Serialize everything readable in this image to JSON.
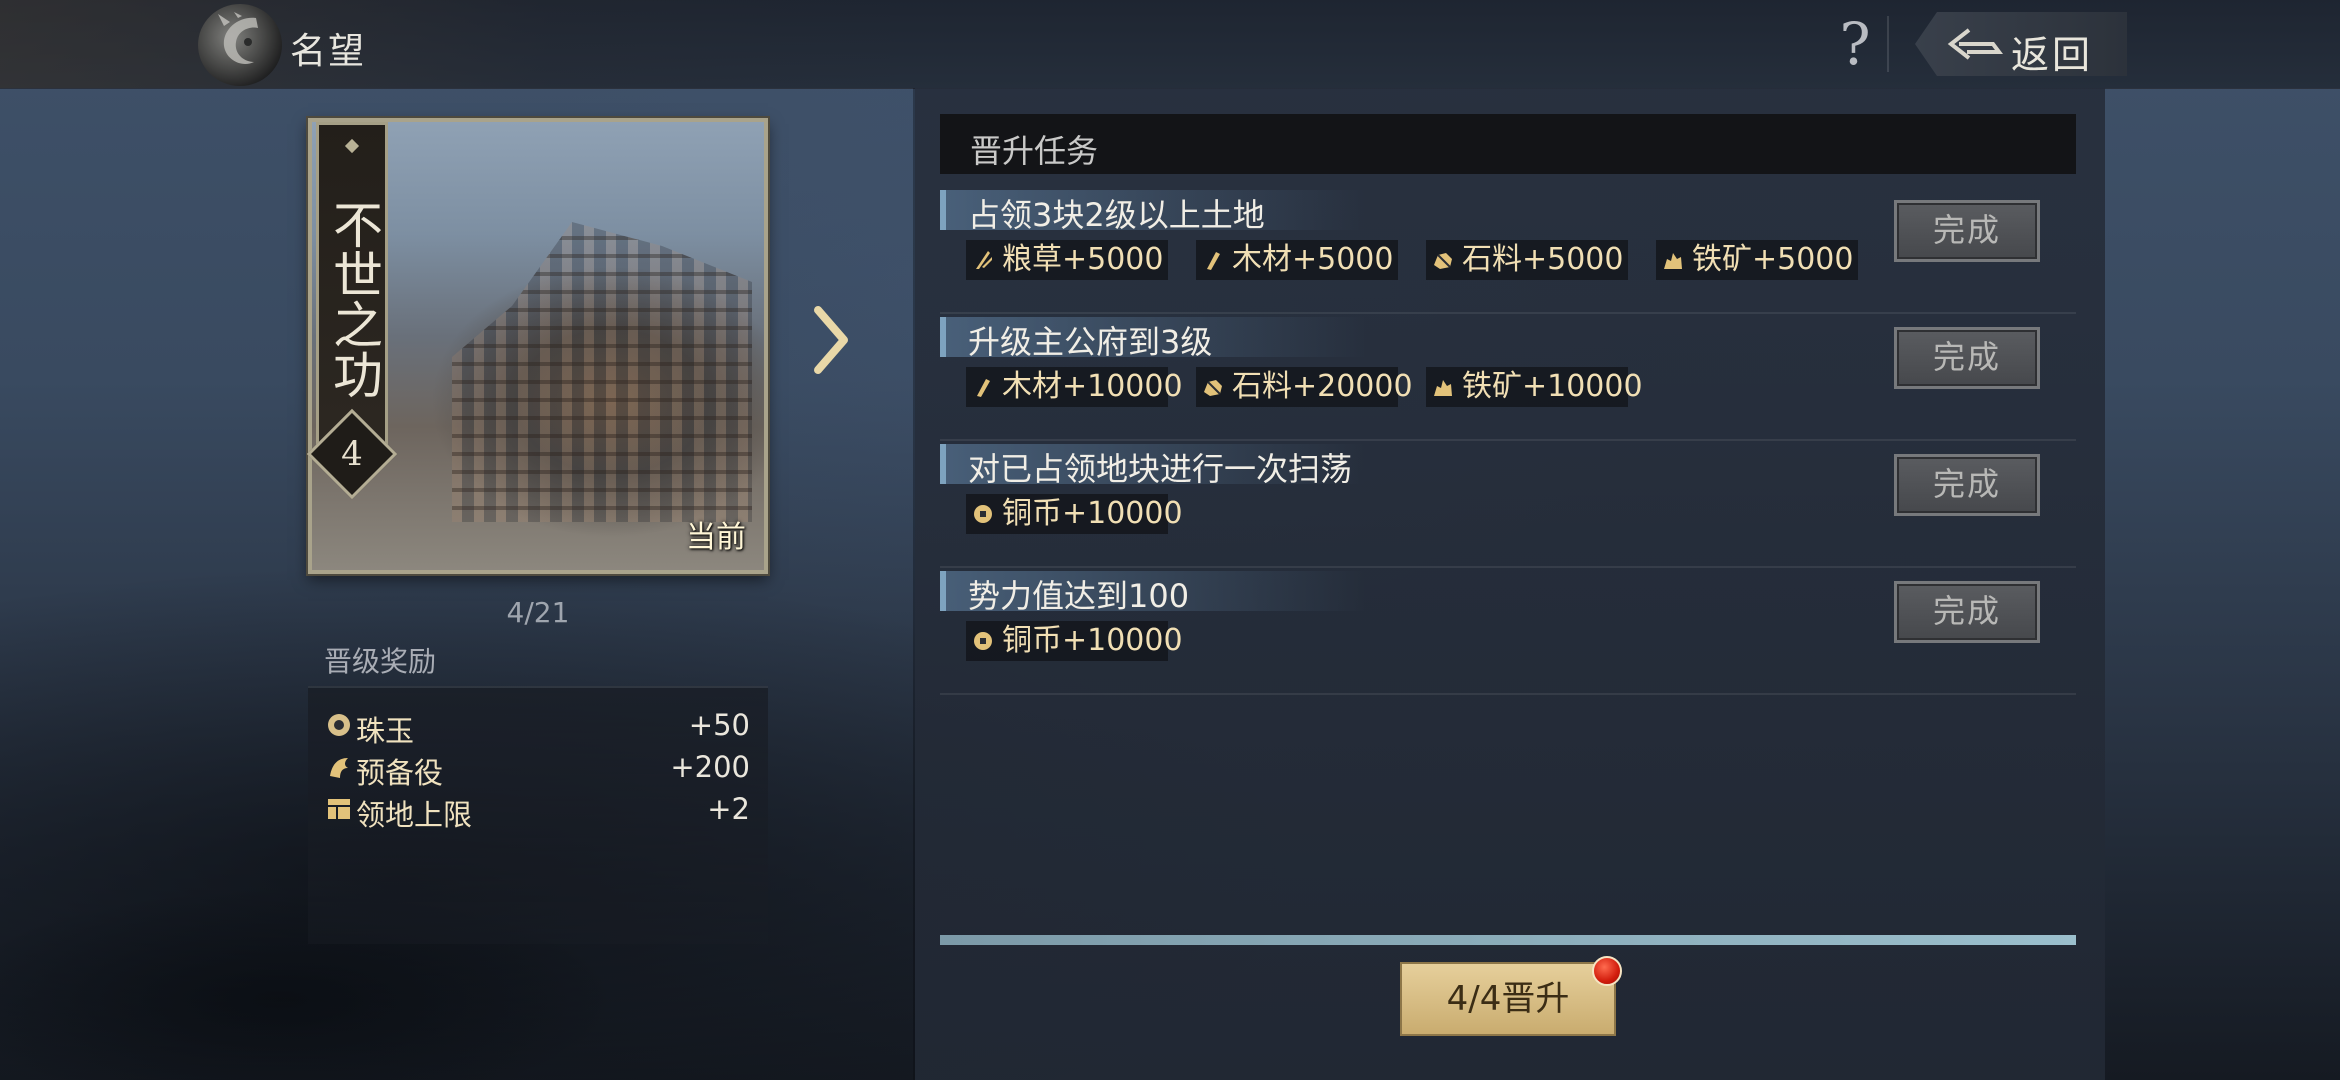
{
  "header": {
    "title": "名望",
    "help_icon": "question-mark-icon",
    "back_label": "返回",
    "back_icon": "double-chevron-left-icon"
  },
  "rank_card": {
    "name": "不世之功",
    "level": "4",
    "current_tag": "当前",
    "progress": "4/21"
  },
  "rewards": {
    "heading": "晋级奖励",
    "items": [
      {
        "icon": "jade-icon",
        "name": "珠玉",
        "value": "+50"
      },
      {
        "icon": "reserve-troops-icon",
        "name": "预备役",
        "value": "+200"
      },
      {
        "icon": "territory-icon",
        "name": "领地上限",
        "value": "+2"
      }
    ]
  },
  "tasks": {
    "heading": "晋升任务",
    "items": [
      {
        "title": "占领3块2级以上土地",
        "rewards": [
          {
            "icon": "grain-icon",
            "text": "粮草+5000"
          },
          {
            "icon": "wood-icon",
            "text": "木材+5000"
          },
          {
            "icon": "stone-icon",
            "text": "石料+5000"
          },
          {
            "icon": "iron-icon",
            "text": "铁矿+5000"
          }
        ],
        "button": "完成"
      },
      {
        "title": "升级主公府到3级",
        "rewards": [
          {
            "icon": "wood-icon",
            "text": "木材+10000"
          },
          {
            "icon": "stone-icon",
            "text": "石料+20000"
          },
          {
            "icon": "iron-icon",
            "text": "铁矿+10000"
          }
        ],
        "button": "完成"
      },
      {
        "title": "对已占领地块进行一次扫荡",
        "rewards": [
          {
            "icon": "copper-coin-icon",
            "text": "铜币+10000"
          }
        ],
        "button": "完成"
      },
      {
        "title": "势力值达到100",
        "rewards": [
          {
            "icon": "copper-coin-icon",
            "text": "铜币+10000"
          }
        ],
        "button": "完成"
      }
    ],
    "completion": 1.0,
    "promote_label": "4/4晋升"
  },
  "colors": {
    "accent_gold": "#e6cf9b",
    "reward_text": "#f1dfb4",
    "notify_red": "#d21d0d",
    "task_band": "#7ea3bf"
  }
}
